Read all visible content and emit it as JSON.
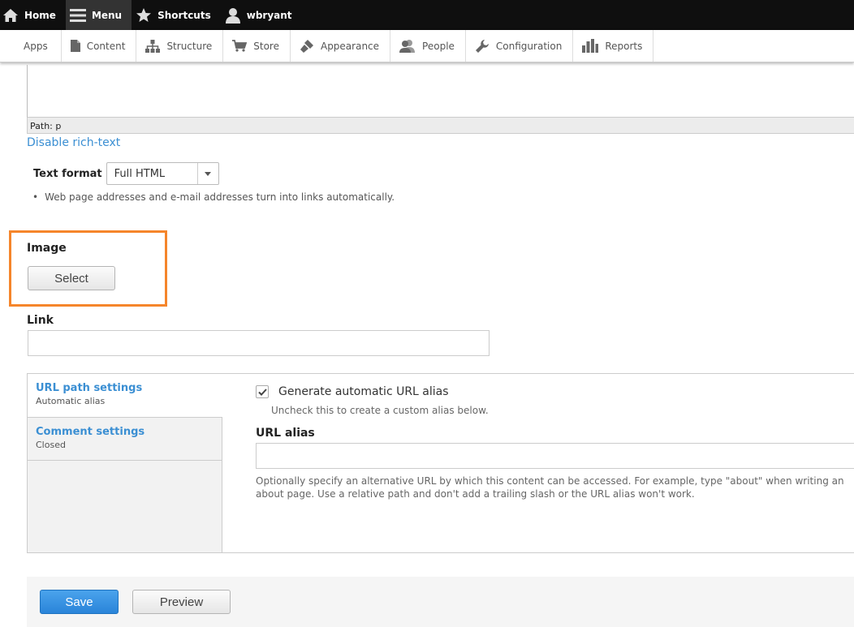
{
  "toolbar": {
    "home": "Home",
    "menu": "Menu",
    "shortcuts": "Shortcuts",
    "user": "wbryant"
  },
  "tray": {
    "items": [
      "Apps",
      "Content",
      "Structure",
      "Store",
      "Appearance",
      "People",
      "Configuration",
      "Reports"
    ]
  },
  "editor": {
    "path": "Path: p",
    "disable_rich_text": "Disable rich-text"
  },
  "text_format": {
    "label": "Text format",
    "selected": "Full HTML",
    "tip": "Web page addresses and e-mail addresses turn into links automatically."
  },
  "image": {
    "label": "Image",
    "select_button": "Select"
  },
  "link": {
    "label": "Link",
    "value": ""
  },
  "vertical_tabs": {
    "tabs": [
      {
        "title": "URL path settings",
        "summary": "Automatic alias"
      },
      {
        "title": "Comment settings",
        "summary": "Closed"
      }
    ],
    "url_path": {
      "checkbox_label": "Generate automatic URL alias",
      "checked": true,
      "checkbox_desc": "Uncheck this to create a custom alias below.",
      "alias_label": "URL alias",
      "alias_value": "",
      "alias_desc": "Optionally specify an alternative URL by which this content can be accessed. For example, type \"about\" when writing an about page. Use a relative path and don't add a trailing slash or the URL alias won't work."
    }
  },
  "actions": {
    "save": "Save",
    "preview": "Preview"
  },
  "colors": {
    "highlight": "#f5852b",
    "link": "#3b8fd3",
    "primary_button": "#2a84d9"
  }
}
